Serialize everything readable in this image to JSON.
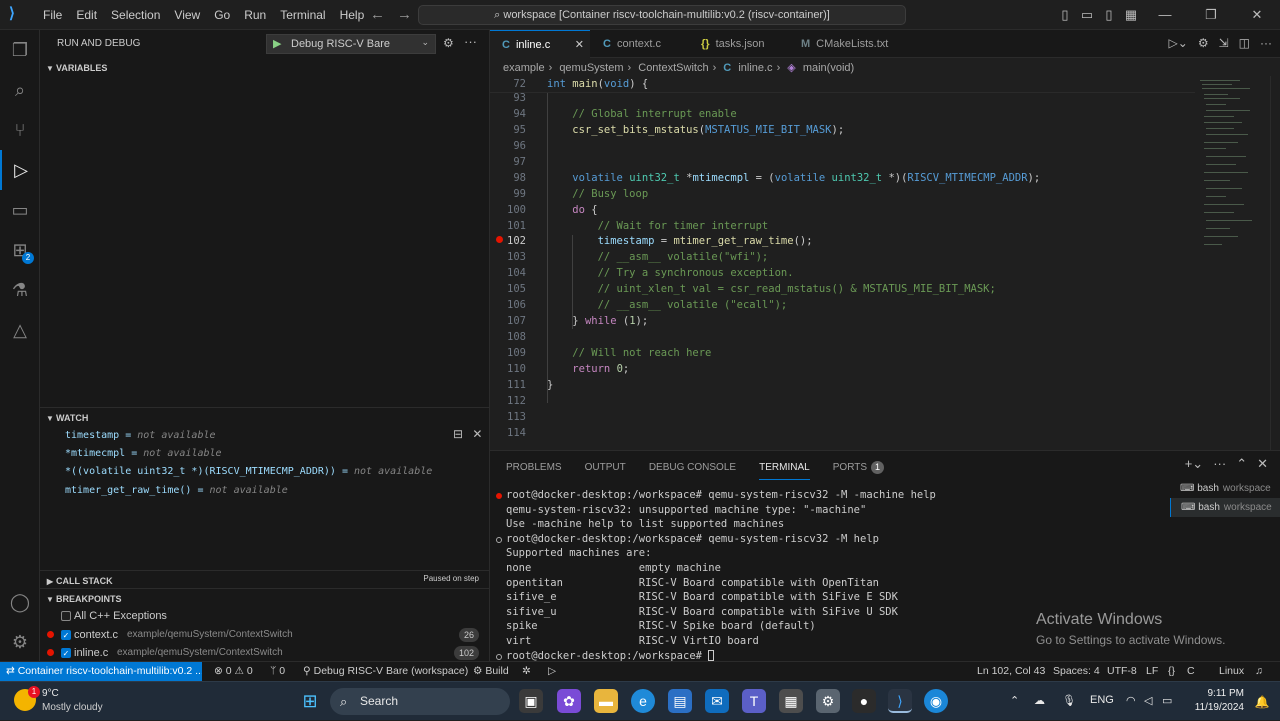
{
  "window": {
    "menus": [
      "File",
      "Edit",
      "Selection",
      "View",
      "Go",
      "Run",
      "Terminal",
      "Help"
    ],
    "command_center": "workspace [Container riscv-toolchain-multilib:v0.2 (riscv-container)]"
  },
  "activity_bar": {
    "items": [
      "explorer-icon",
      "search-icon",
      "source-control-icon",
      "run-debug-icon",
      "remote-explorer-icon",
      "extensions-icon",
      "testing-icon",
      "cmake-icon"
    ],
    "extensions_badge": "2",
    "bottom": [
      "account-icon",
      "manage-gear-icon"
    ]
  },
  "sidebar": {
    "title": "RUN AND DEBUG",
    "config": "Debug RISC-V Bare",
    "variables_header": "VARIABLES",
    "watch_header": "WATCH",
    "watch": [
      {
        "expr": "timestamp",
        "value": "not available"
      },
      {
        "expr": "*mtimecmpl",
        "value": "not available"
      },
      {
        "expr": "*((volatile uint32_t *)(RISCV_MTIMECMP_ADDR))",
        "value": "not available"
      },
      {
        "expr": "mtimer_get_raw_time()",
        "value": "not available"
      }
    ],
    "call_stack_header": "CALL STACK",
    "paused_on": "Paused on step",
    "breakpoints_header": "BREAKPOINTS",
    "breakpoints": [
      {
        "name": "All C++ Exceptions",
        "path": "",
        "count": ""
      },
      {
        "name": "context.c",
        "path": "example/qemuSystem/ContextSwitch",
        "count": "26"
      },
      {
        "name": "inline.c",
        "path": "example/qemuSystem/ContextSwitch",
        "count": "102"
      }
    ]
  },
  "tabs": [
    {
      "icon": "C",
      "label": "inline.c",
      "active": true
    },
    {
      "icon": "C",
      "label": "context.c"
    },
    {
      "icon": "{}",
      "label": "tasks.json"
    },
    {
      "icon": "M",
      "label": "CMakeLists.txt"
    }
  ],
  "breadcrumb": [
    "example",
    "qemuSystem",
    "ContextSwitch",
    "inline.c",
    "main(void)"
  ],
  "code": {
    "sticky_line": "72",
    "lines": [
      {
        "n": "93",
        "text": ""
      },
      {
        "n": "94",
        "text": "    // Global interrupt enable"
      },
      {
        "n": "95",
        "text": "    csr_set_bits_mstatus(MSTATUS_MIE_BIT_MASK);"
      },
      {
        "n": "96",
        "text": ""
      },
      {
        "n": "97",
        "text": ""
      },
      {
        "n": "98",
        "text": "    volatile uint32_t *mtimecmpl = (volatile uint32_t *)(RISCV_MTIMECMP_ADDR);"
      },
      {
        "n": "99",
        "text": "    // Busy loop"
      },
      {
        "n": "100",
        "text": "    do {"
      },
      {
        "n": "101",
        "text": "        // Wait for timer interrupt"
      },
      {
        "n": "102",
        "text": "        timestamp = mtimer_get_raw_time();"
      },
      {
        "n": "103",
        "text": "        // __asm__ volatile(\"wfi\");"
      },
      {
        "n": "104",
        "text": "        // Try a synchronous exception."
      },
      {
        "n": "105",
        "text": "        // uint_xlen_t val = csr_read_mstatus() & MSTATUS_MIE_BIT_MASK;"
      },
      {
        "n": "106",
        "text": "        // __asm__ volatile (\"ecall\");"
      },
      {
        "n": "107",
        "text": "    } while (1);"
      },
      {
        "n": "108",
        "text": ""
      },
      {
        "n": "109",
        "text": "    // Will not reach here"
      },
      {
        "n": "110",
        "text": "    return 0;"
      },
      {
        "n": "111",
        "text": "}"
      },
      {
        "n": "112",
        "text": ""
      },
      {
        "n": "113",
        "text": ""
      },
      {
        "n": "114",
        "text": ""
      }
    ],
    "breakpoint_line": "102"
  },
  "panel": {
    "tabs": [
      "PROBLEMS",
      "OUTPUT",
      "DEBUG CONSOLE",
      "TERMINAL",
      "PORTS"
    ],
    "ports_badge": "1",
    "terminal_lines": [
      "root@docker-desktop:/workspace# qemu-system-riscv32 -M -machine help",
      "qemu-system-riscv32: unsupported machine type: \"-machine\"",
      "Use -machine help to list supported machines",
      "root@docker-desktop:/workspace# qemu-system-riscv32 -M help",
      "Supported machines are:",
      "none                 empty machine",
      "opentitan            RISC-V Board compatible with OpenTitan",
      "sifive_e             RISC-V Board compatible with SiFive E SDK",
      "sifive_u             RISC-V Board compatible with SiFive U SDK",
      "spike                RISC-V Spike board (default)",
      "virt                 RISC-V VirtIO board",
      "root@docker-desktop:/workspace# "
    ],
    "terminals": [
      {
        "name": "bash",
        "ws": "workspace"
      },
      {
        "name": "bash",
        "ws": "workspace"
      }
    ],
    "activate_title": "Activate Windows",
    "activate_sub": "Go to Settings to activate Windows."
  },
  "status": {
    "remote": "Container riscv-toolchain-multilib:v0.2 ...",
    "errors": "0",
    "warnings": "0",
    "ports": "0",
    "debug": "Debug RISC-V Bare (workspace)",
    "build": "Build",
    "position": "Ln 102, Col 43",
    "spaces": "Spaces: 4",
    "encoding": "UTF-8",
    "eol": "LF",
    "lang": "C",
    "os": "Linux"
  },
  "taskbar": {
    "temp": "9°C",
    "weather": "Mostly cloudy",
    "weather_badge": "1",
    "search": "Search",
    "lang": "ENG",
    "time": "9:11 PM",
    "date": "11/19/2024"
  },
  "colors": {
    "accent": "#0078d4",
    "breakpoint": "#e51400"
  }
}
